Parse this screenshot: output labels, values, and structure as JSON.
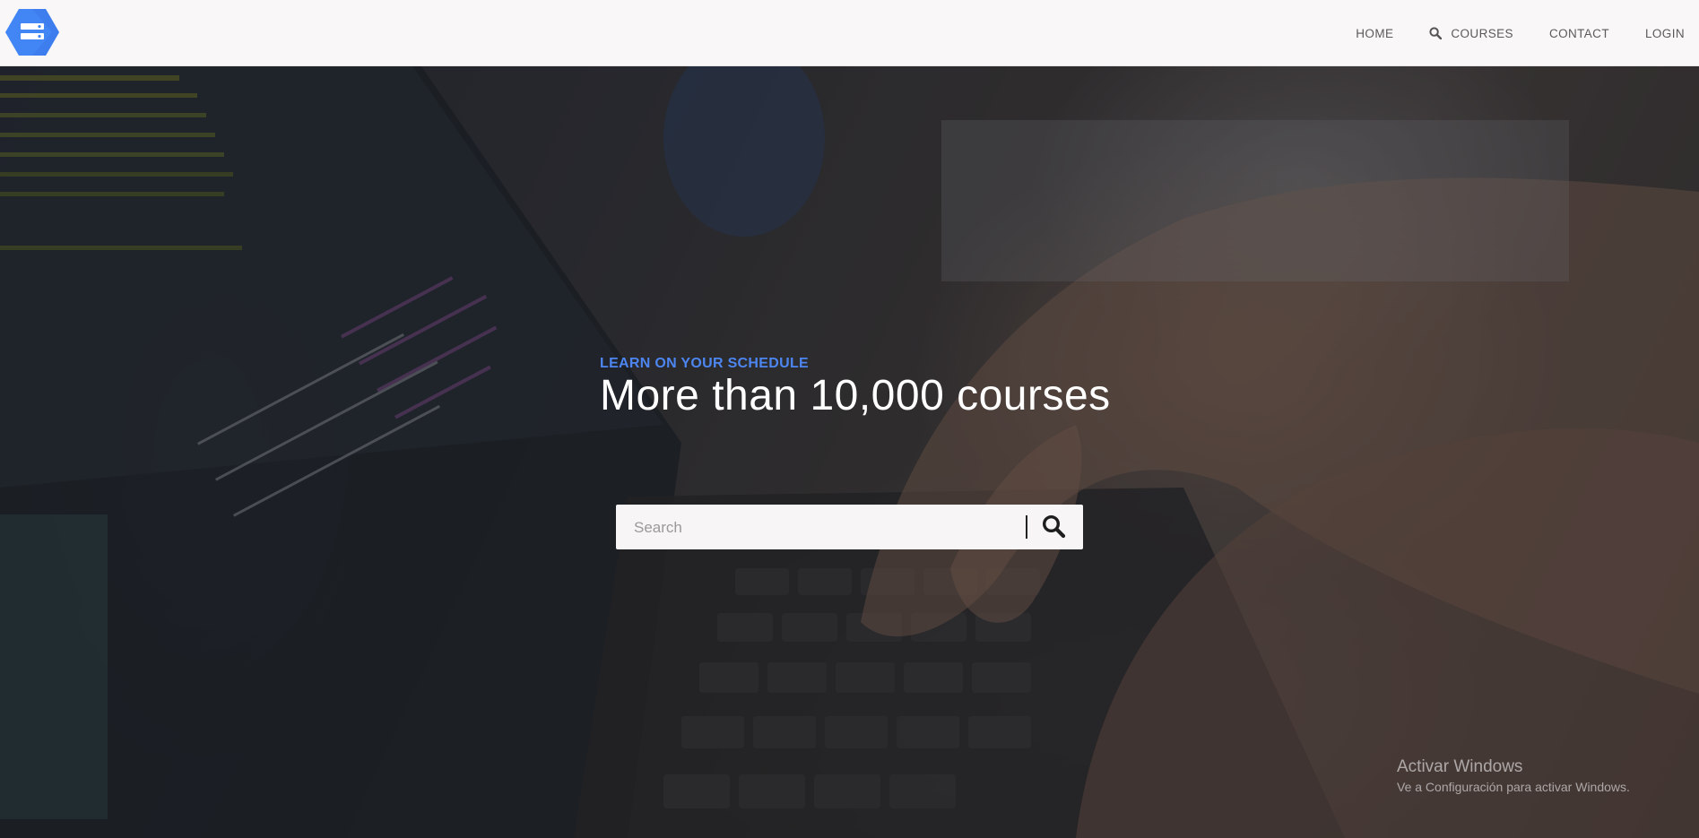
{
  "nav": {
    "logo_icon": "cloud-storage-hexagon-icon",
    "brand_color": "#4285f4",
    "links": [
      {
        "label": "HOME"
      },
      {
        "label": "COURSES",
        "icon": "search-icon"
      },
      {
        "label": "CONTACT"
      },
      {
        "label": "LOGIN"
      }
    ]
  },
  "hero": {
    "eyebrow": "LEARN ON YOUR SCHEDULE",
    "title": "More than 10,000 courses",
    "accent_color": "#4d86f0",
    "search": {
      "placeholder": "Search",
      "value": "",
      "button_icon": "search-icon"
    }
  },
  "watermark": {
    "line1": "Activar Windows",
    "line2": "Ve a Configuración para activar Windows."
  }
}
